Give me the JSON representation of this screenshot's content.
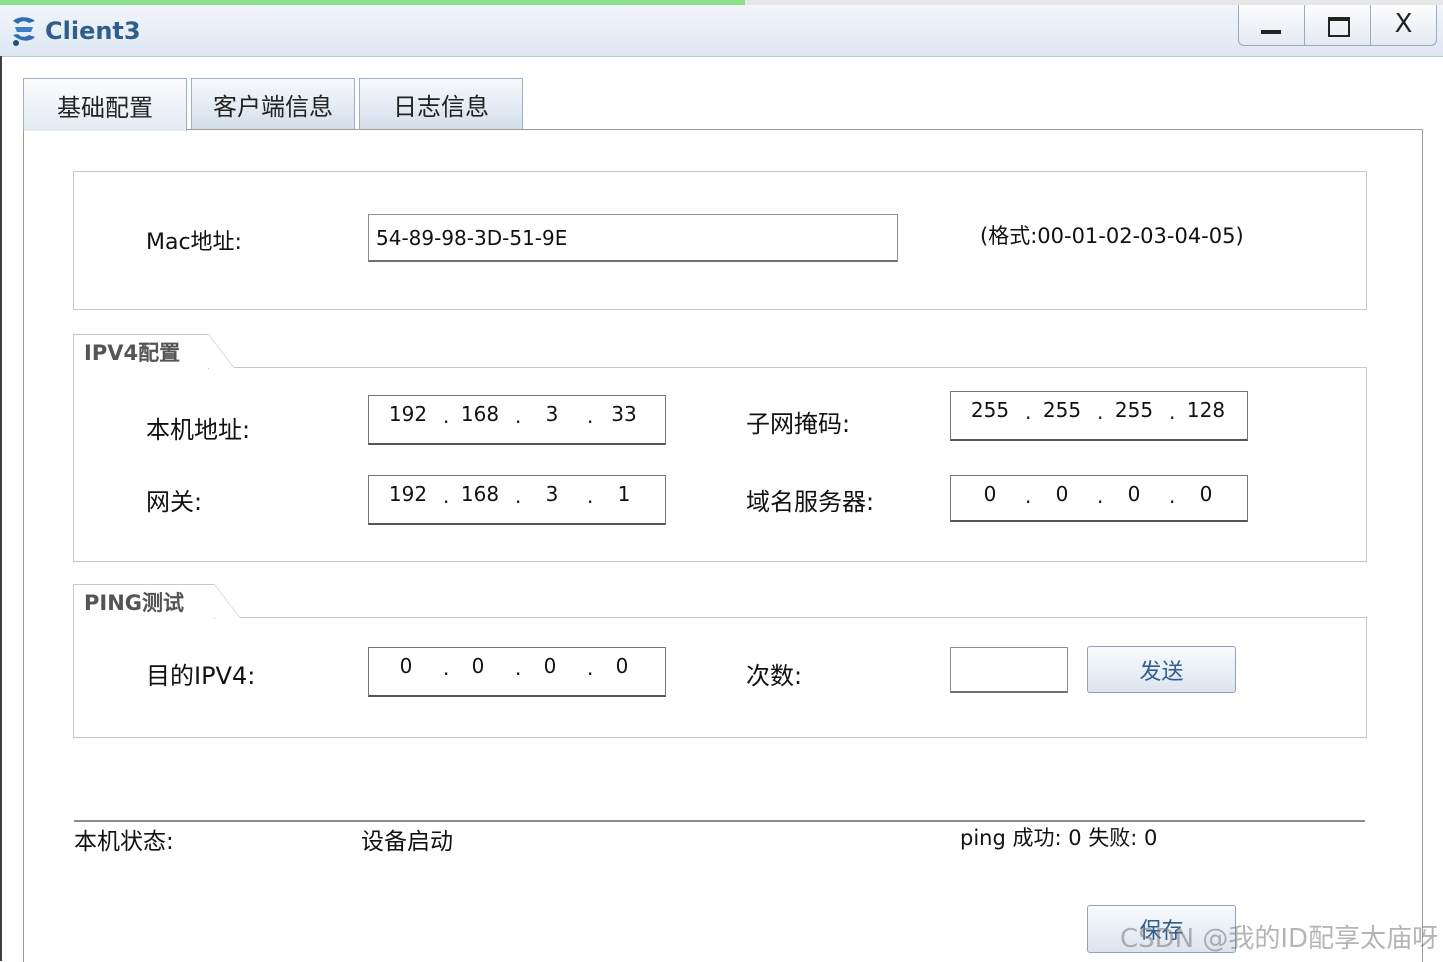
{
  "window": {
    "title": "Client3",
    "close_symbol": "X"
  },
  "tabs": [
    "基础配置",
    "客户端信息",
    "日志信息"
  ],
  "mac": {
    "label": "Mac地址:",
    "value": "54-89-98-3D-51-9E",
    "hint": "(格式:00-01-02-03-04-05)"
  },
  "ipv4": {
    "legend": "IPV4配置",
    "local_label": "本机地址:",
    "local_ip": [
      "192",
      "168",
      "3",
      "33"
    ],
    "gateway_label": "网关:",
    "gateway_ip": [
      "192",
      "168",
      "3",
      "1"
    ],
    "mask_label": "子网掩码:",
    "mask_ip": [
      "255",
      "255",
      "255",
      "128"
    ],
    "dns_label": "域名服务器:",
    "dns_ip": [
      "0",
      "0",
      "0",
      "0"
    ]
  },
  "ping": {
    "legend": "PING测试",
    "target_label": "目的IPV4:",
    "target_ip": [
      "0",
      "0",
      "0",
      "0"
    ],
    "count_label": "次数:",
    "count_value": "",
    "send_label": "发送"
  },
  "status": {
    "label": "本机状态:",
    "value": "设备启动",
    "ping_result": "ping 成功: 0 失败: 0"
  },
  "save_label": "保存",
  "watermark": "CSDN @我的ID配享太庙呀"
}
